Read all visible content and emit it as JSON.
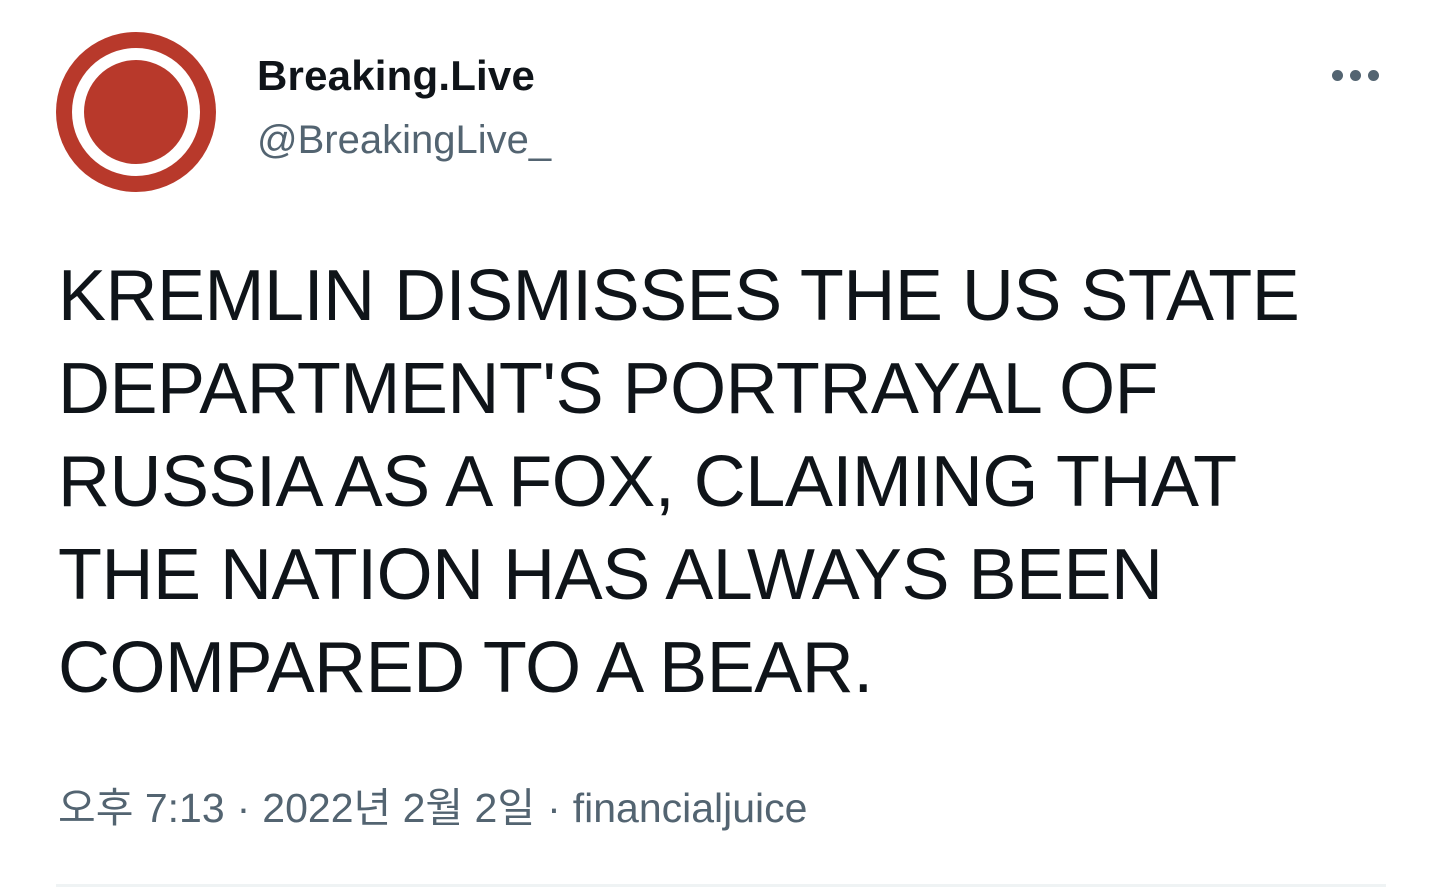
{
  "author": {
    "display_name": "Breaking.Live",
    "handle": "@BreakingLive_",
    "avatar_icon": "record-circle-logo",
    "avatar_color": "#b8392b"
  },
  "menu": {
    "icon": "more-horizontal-icon"
  },
  "tweet": {
    "text": "KREMLIN DISMISSES THE US STATE DEPARTMENT'S PORTRAYAL OF RUSSIA AS A FOX, CLAIMING THAT THE NATION HAS ALWAYS BEEN COMPARED TO A BEAR."
  },
  "meta": {
    "time": "오후 7:13",
    "separator": "·",
    "date": "2022년 2월 2일",
    "source": "financialjuice"
  },
  "colors": {
    "text_primary": "#0f1419",
    "text_secondary": "#536471",
    "divider": "#eff3f4"
  }
}
